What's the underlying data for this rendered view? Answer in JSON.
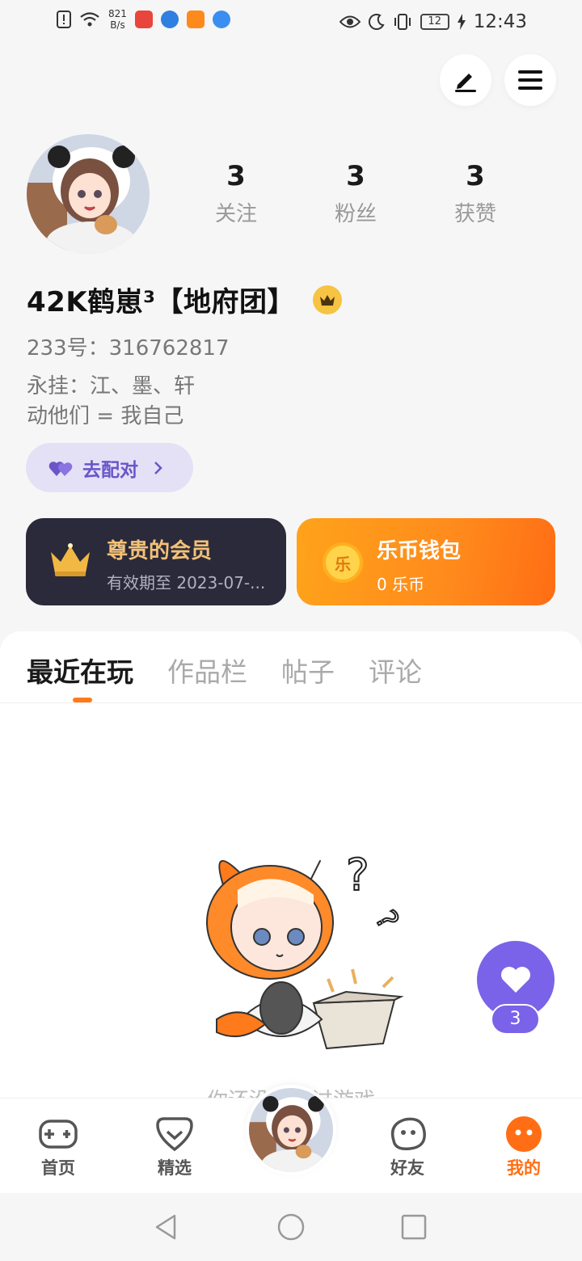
{
  "status_bar": {
    "net_speed_value": "821",
    "net_speed_unit": "B/s",
    "battery": "12",
    "time": "12:43"
  },
  "header": {
    "edit_icon": "pen-icon",
    "menu_icon": "hamburger-icon"
  },
  "profile": {
    "stats": [
      {
        "value": "3",
        "label": "关注"
      },
      {
        "value": "3",
        "label": "粉丝"
      },
      {
        "value": "3",
        "label": "获赞"
      }
    ],
    "username": "42K鹤崽³【地府团】",
    "uid": "233号：316762817",
    "bio_line1": "永挂：江、墨、轩",
    "bio_line2": "动他们 = 我自己",
    "match_label": "去配对"
  },
  "cards": {
    "vip_title": "尊贵的会员",
    "vip_sub": "有效期至 2023-07-...",
    "wallet_title": "乐币钱包",
    "wallet_sub": "0 乐币",
    "coin_glyph": "乐"
  },
  "tabs": [
    "最近在玩",
    "作品栏",
    "帖子",
    "评论"
  ],
  "empty_text": "你还没有玩过游戏",
  "like_count": "3",
  "bottom_nav": [
    {
      "label": "首页",
      "icon": "gamepad-icon"
    },
    {
      "label": "精选",
      "icon": "heart-badge-icon"
    },
    {
      "label": "好友",
      "icon": "planet-icon"
    },
    {
      "label": "我的",
      "icon": "face-icon"
    }
  ],
  "colors": {
    "accent": "#ff6e14",
    "purple": "#7a63e8",
    "vip_gold": "#f3c178"
  }
}
